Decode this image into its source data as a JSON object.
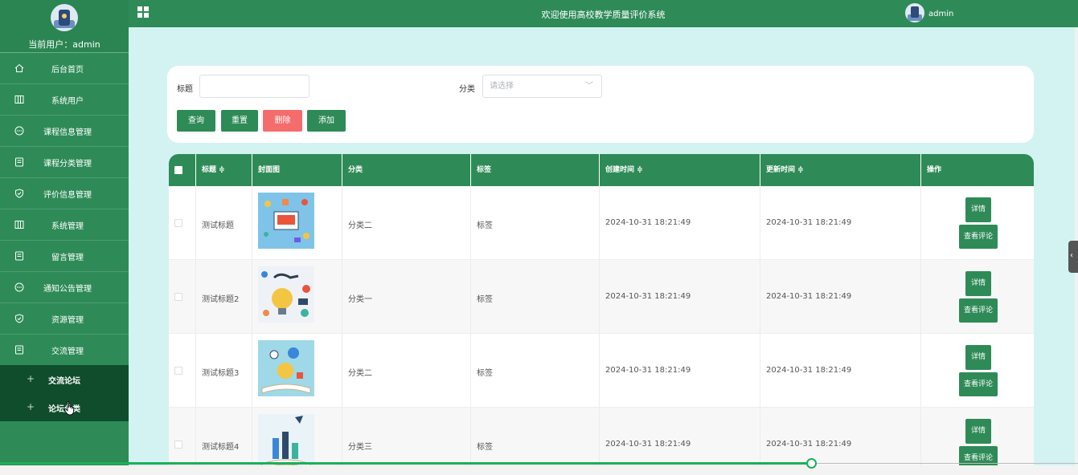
{
  "sidebar": {
    "current_user": "当前用户：admin",
    "items": [
      {
        "label": "后台首页",
        "icon": "home-icon"
      },
      {
        "label": "系统用户",
        "icon": "columns-icon"
      },
      {
        "label": "课程信息管理",
        "icon": "chat-icon"
      },
      {
        "label": "课程分类管理",
        "icon": "document-icon"
      },
      {
        "label": "评价信息管理",
        "icon": "shield-icon"
      },
      {
        "label": "系统管理",
        "icon": "columns-icon"
      },
      {
        "label": "留言管理",
        "icon": "document-icon"
      },
      {
        "label": "通知公告管理",
        "icon": "chat-icon"
      },
      {
        "label": "资源管理",
        "icon": "shield-icon"
      },
      {
        "label": "交流管理",
        "icon": "document-icon"
      }
    ],
    "sub_items": [
      {
        "label": "交流论坛"
      },
      {
        "label": "论坛分类"
      }
    ]
  },
  "topbar": {
    "title": "欢迎使用高校教学质量评价系统",
    "user": "admin"
  },
  "search": {
    "title_label": "标题",
    "title_value": "",
    "category_label": "分类",
    "category_placeholder": "请选择",
    "buttons": {
      "query": "查询",
      "reset": "重置",
      "delete": "删除",
      "add": "添加"
    }
  },
  "table": {
    "headers": {
      "title": "标题 ≑",
      "cover": "封面图",
      "category": "分类",
      "tag": "标签",
      "created": "创建时间 ≑",
      "updated": "更新时间 ≑",
      "actions": "操作"
    },
    "rows": [
      {
        "title": "测试标题",
        "category": "分类二",
        "tag": "标签",
        "created": "2024-10-31 18:21:49",
        "updated": "2024-10-31 18:21:49",
        "detail": "详情",
        "review": "查看评论"
      },
      {
        "title": "测试标题2",
        "category": "分类一",
        "tag": "标签",
        "created": "2024-10-31 18:21:49",
        "updated": "2024-10-31 18:21:49",
        "detail": "详情",
        "review": "查看评论"
      },
      {
        "title": "测试标题3",
        "category": "分类二",
        "tag": "标签",
        "created": "2024-10-31 18:21:49",
        "updated": "2024-10-31 18:21:49",
        "detail": "详情",
        "review": "查看评论"
      },
      {
        "title": "测试标题4",
        "category": "分类三",
        "tag": "标签",
        "created": "2024-10-31 18:21:49",
        "updated": "2024-10-31 18:21:49",
        "detail": "详情",
        "review": "查看评论"
      }
    ]
  },
  "colors": {
    "primary": "#2e8b57",
    "danger": "#f56c6c",
    "background": "#d3f3f2",
    "submenu": "#0f4d2c"
  }
}
